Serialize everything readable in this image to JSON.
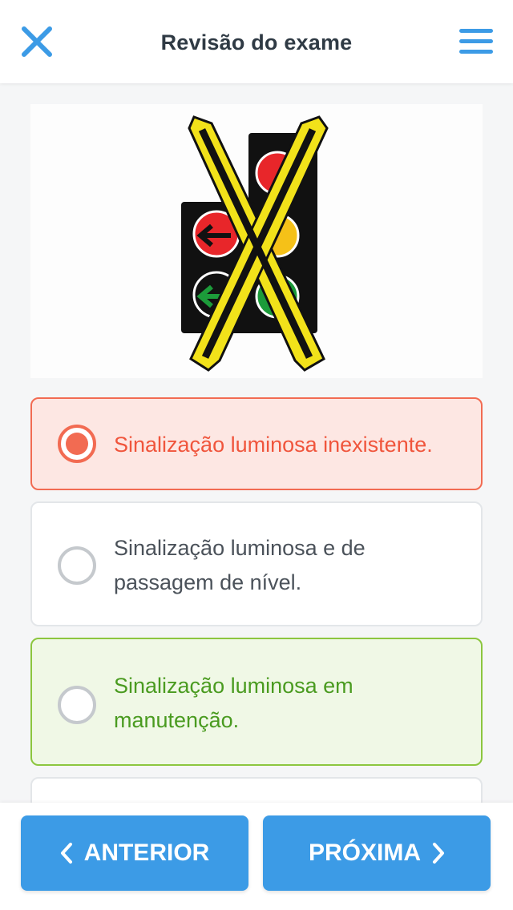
{
  "header": {
    "title": "Revisão do exame",
    "close_icon": "close-icon",
    "menu_icon": "hamburger-menu-icon"
  },
  "question": {
    "image": "traffic-light-crossed-out-sign"
  },
  "options": [
    {
      "label": "Sinalização luminosa inexistente.",
      "state": "selected-wrong"
    },
    {
      "label": "Sinalização luminosa e de passagem de nível.",
      "state": "unselected"
    },
    {
      "label": "Sinalização luminosa em manutenção.",
      "state": "correct"
    },
    {
      "label": "",
      "state": "unselected"
    }
  ],
  "footer": {
    "prev_label": "ANTERIOR",
    "next_label": "PRÓXIMA"
  },
  "colors": {
    "accent": "#3c9be6",
    "wrong": "#f26b52",
    "correct": "#8cc63f",
    "title": "#2f3a44"
  }
}
